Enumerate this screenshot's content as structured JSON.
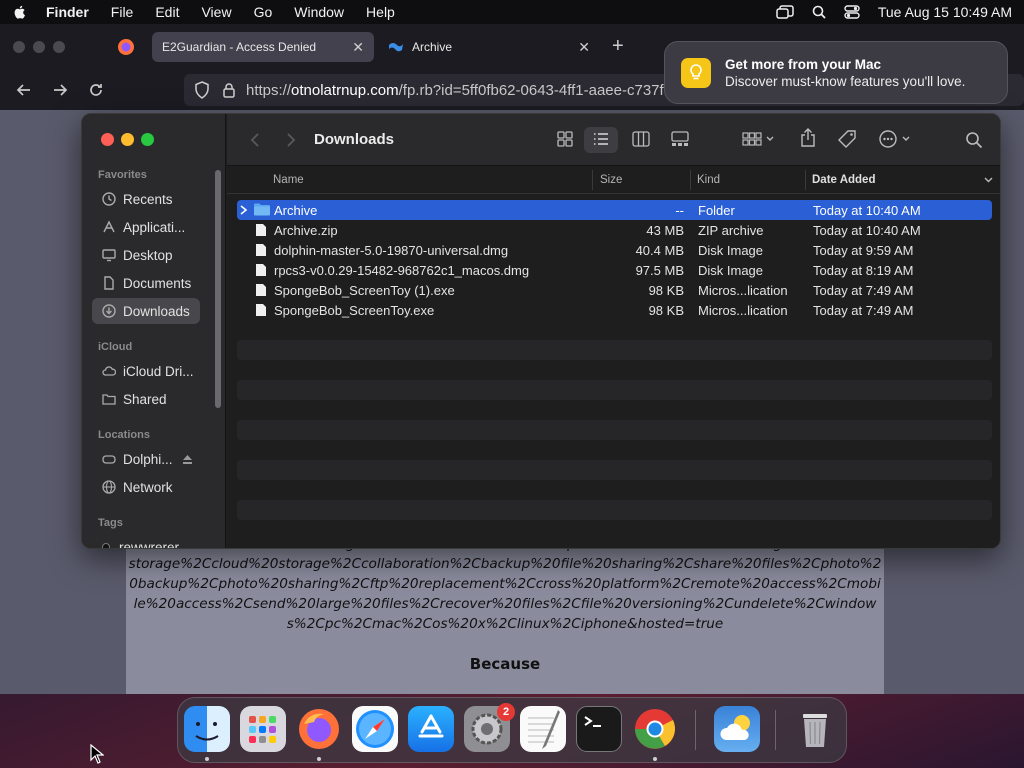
{
  "menubar": {
    "app_name": "Finder",
    "items": [
      "File",
      "Edit",
      "View",
      "Go",
      "Window",
      "Help"
    ],
    "datetime": "Tue Aug 15  10:49 AM"
  },
  "browser": {
    "tabs": [
      {
        "label": "E2Guardian - Access Denied"
      },
      {
        "label": "Archive"
      }
    ],
    "url_scheme": "https://",
    "url_host": "otnolatrnup.com",
    "url_path": "/fp.rb?id=5ff0fb62-0643-4ff1-aaee-c737f"
  },
  "notification": {
    "title": "Get more from your Mac",
    "body": "Discover must-know features you'll love."
  },
  "page": {
    "text": "www.mediafire.com%2Ffile%2Fgzda31o1rhwo6on%2FArchive.zip%2Ffile&kw=online%20storage%2Cfree%20storage%2Ccloud%20storage%2Ccollaboration%2Cbackup%20file%20sharing%2Cshare%20files%2Cphoto%20backup%2Cphoto%20sharing%2Cftp%20replacement%2Ccross%20platform%2Cremote%20access%2Cmobile%20access%2Csend%20large%20files%2Crecover%20files%2Cfile%20versioning%2Cundelete%2Cwindows%2Cpc%2Cmac%2Cos%20x%2Clinux%2Ciphone&hosted=true",
    "because": "Because"
  },
  "finder": {
    "title": "Downloads",
    "sidebar": {
      "favorites_header": "Favorites",
      "favorites": [
        {
          "label": "Recents",
          "icon": "clock-icon"
        },
        {
          "label": "Applicati...",
          "icon": "applications-icon"
        },
        {
          "label": "Desktop",
          "icon": "desktop-icon"
        },
        {
          "label": "Documents",
          "icon": "document-icon"
        },
        {
          "label": "Downloads",
          "icon": "download-icon"
        }
      ],
      "icloud_header": "iCloud",
      "icloud": [
        {
          "label": "iCloud Dri...",
          "icon": "cloud-icon"
        },
        {
          "label": "Shared",
          "icon": "shared-folder-icon"
        }
      ],
      "locations_header": "Locations",
      "locations": [
        {
          "label": "Dolphi...",
          "icon": "disk-icon"
        },
        {
          "label": "Network",
          "icon": "globe-icon"
        }
      ],
      "tags_header": "Tags",
      "tags": [
        {
          "label": "rewwrerer"
        }
      ]
    },
    "columns": {
      "name": "Name",
      "size": "Size",
      "kind": "Kind",
      "date": "Date Added"
    },
    "files": [
      {
        "name": "Archive",
        "size": "--",
        "kind": "Folder",
        "date": "Today at 10:40 AM",
        "icon": "folder-icon"
      },
      {
        "name": "Archive.zip",
        "size": "43 MB",
        "kind": "ZIP archive",
        "date": "Today at 10:40 AM",
        "icon": "file-icon"
      },
      {
        "name": "dolphin-master-5.0-19870-universal.dmg",
        "size": "40.4 MB",
        "kind": "Disk Image",
        "date": "Today at 9:59 AM",
        "icon": "file-icon"
      },
      {
        "name": "rpcs3-v0.0.29-15482-968762c1_macos.dmg",
        "size": "97.5 MB",
        "kind": "Disk Image",
        "date": "Today at 8:19 AM",
        "icon": "file-icon"
      },
      {
        "name": "SpongeBob_ScreenToy (1).exe",
        "size": "98 KB",
        "kind": "Micros...lication",
        "date": "Today at 7:49 AM",
        "icon": "file-icon"
      },
      {
        "name": "SpongeBob_ScreenToy.exe",
        "size": "98 KB",
        "kind": "Micros...lication",
        "date": "Today at 7:49 AM",
        "icon": "file-icon"
      }
    ]
  },
  "dock": {
    "apps": [
      "finder",
      "launchpad",
      "firefox",
      "safari",
      "app-store",
      "system-settings",
      "textedit",
      "terminal",
      "chrome",
      "weather",
      "trash"
    ],
    "settings_badge": "2"
  },
  "colors": {
    "selection": "#2a5fd6",
    "folder": "#5aa9f0",
    "close": "#ff5f57",
    "minimize": "#febc2e",
    "zoom": "#28c840"
  }
}
